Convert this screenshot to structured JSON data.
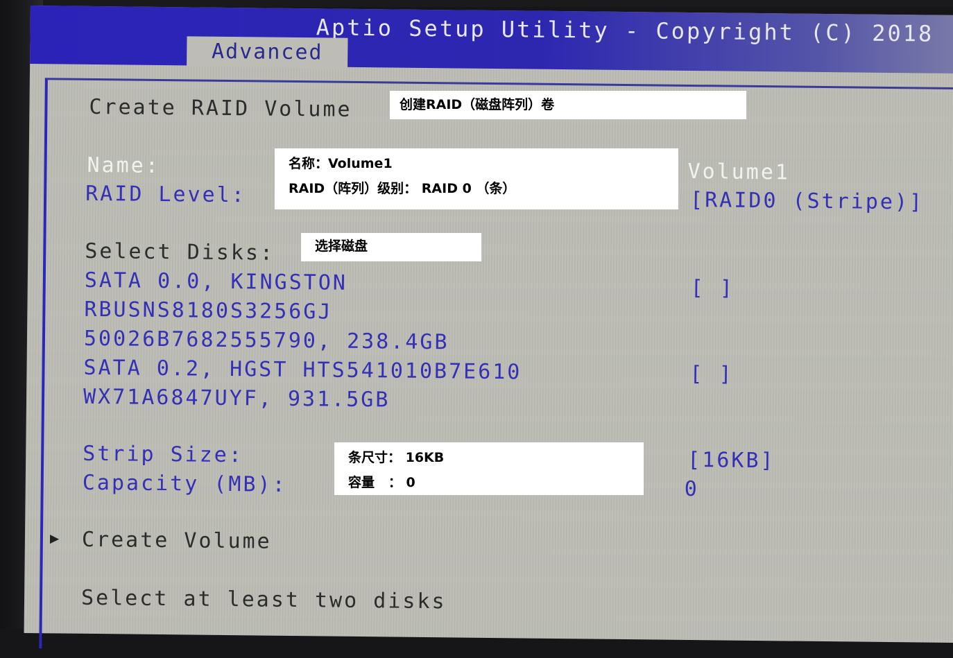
{
  "window": {
    "title": "Aptio Setup Utility - Copyright (C) 2018"
  },
  "tabs": [
    {
      "label": "Advanced",
      "active": true
    }
  ],
  "page": {
    "heading": "Create RAID Volume",
    "fields": {
      "name": {
        "label": "Name:",
        "value": "Volume1"
      },
      "raid_level": {
        "label": "RAID Level:",
        "value": "[RAID0 (Stripe)]"
      },
      "select_disks": {
        "label": "Select Disks:"
      },
      "strip_size": {
        "label": "Strip Size:",
        "value": "[16KB]"
      },
      "capacity": {
        "label": "Capacity (MB):",
        "value": "0"
      }
    },
    "disks": [
      {
        "lines": [
          "SATA 0.0, KINGSTON",
          "RBUSNS8180S3256GJ",
          "50026B7682555790, 238.4GB"
        ],
        "checkbox": "[ ]",
        "selected": false
      },
      {
        "lines": [
          "SATA 0.2, HGST HTS541010B7E610",
          "WX71A6847UYF, 931.5GB"
        ],
        "checkbox": "[ ]",
        "selected": false
      }
    ],
    "action": {
      "label": "Create Volume",
      "icon": "triangle-right-icon"
    },
    "help_text": "Select at least two disks"
  },
  "annotations": {
    "heading": "创建RAID（磁盘阵列）卷",
    "name_level": [
      "名称：Volume1",
      "RAID（阵列）级别： RAID 0 （条）"
    ],
    "select_disks": "选择磁盘",
    "strip_capacity": [
      "条尺寸： 16KB",
      "容量   ： 0"
    ]
  },
  "colors": {
    "title_bar": "#2b23b8",
    "background": "#bdbdb6",
    "item_blue": "#3430b6",
    "heading_dark": "#2c2c2c",
    "selected_white": "#f2f2ee"
  }
}
